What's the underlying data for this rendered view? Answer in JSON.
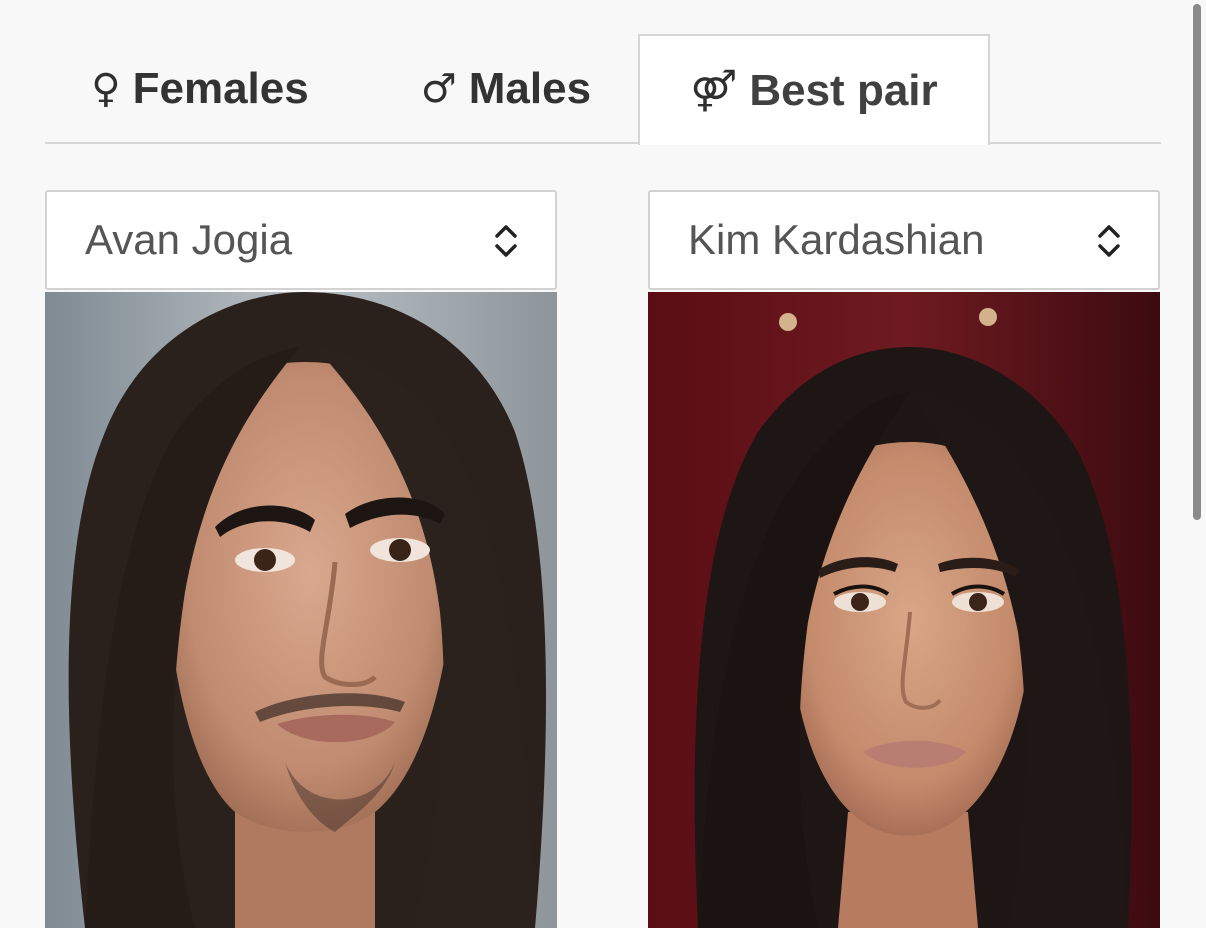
{
  "tabs": [
    {
      "icon": "♀",
      "label": "Females"
    },
    {
      "icon": "♂",
      "label": "Males"
    },
    {
      "icon": "⚤",
      "label": "Best pair"
    }
  ],
  "active_tab": "Best pair",
  "selects": {
    "left": {
      "value": "Avan Jogia"
    },
    "right": {
      "value": "Kim Kardashian"
    }
  },
  "colors": {
    "tab_text": "#333333",
    "border": "#d6d6d6",
    "background": "#f8f8f8",
    "scrollbar": "#8a8a8a"
  }
}
